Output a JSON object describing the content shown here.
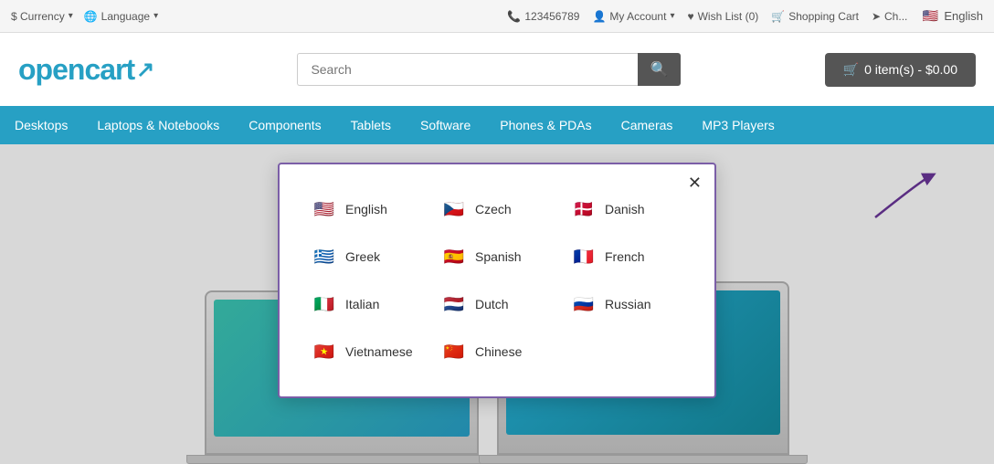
{
  "topbar": {
    "currency_label": "$ Currency",
    "language_label": "🌐 Language",
    "phone": "123456789",
    "my_account": "My Account",
    "wish_list": "Wish List (0)",
    "shopping_cart": "Shopping Cart",
    "checkout": "Ch...",
    "current_language": "English"
  },
  "header": {
    "logo_text": "opencart",
    "search_placeholder": "Search",
    "search_button": "🔍",
    "cart_label": "0 item(s) - $0.00"
  },
  "nav": {
    "items": [
      {
        "label": "Desktops"
      },
      {
        "label": "Laptops & Notebooks"
      },
      {
        "label": "Components"
      },
      {
        "label": "Tablets"
      },
      {
        "label": "Software"
      },
      {
        "label": "Phones & PDAs"
      },
      {
        "label": "Cameras"
      },
      {
        "label": "MP3 Players"
      }
    ]
  },
  "language_modal": {
    "close_label": "✕",
    "languages": [
      {
        "name": "English",
        "flag": "🇺🇸"
      },
      {
        "name": "Czech",
        "flag": "🇨🇿"
      },
      {
        "name": "Danish",
        "flag": "🇩🇰"
      },
      {
        "name": "Greek",
        "flag": "🇬🇷"
      },
      {
        "name": "Spanish",
        "flag": "🇪🇸"
      },
      {
        "name": "French",
        "flag": "🇫🇷"
      },
      {
        "name": "Italian",
        "flag": "🇮🇹"
      },
      {
        "name": "Dutch",
        "flag": "🇳🇱"
      },
      {
        "name": "Russian",
        "flag": "🇷🇺"
      },
      {
        "name": "Vietnamese",
        "flag": "🇻🇳"
      },
      {
        "name": "Chinese",
        "flag": "🇨🇳"
      }
    ]
  },
  "colors": {
    "nav_bg": "#27a0c4",
    "modal_border": "#7b5ea7",
    "logo": "#27a0c4"
  }
}
